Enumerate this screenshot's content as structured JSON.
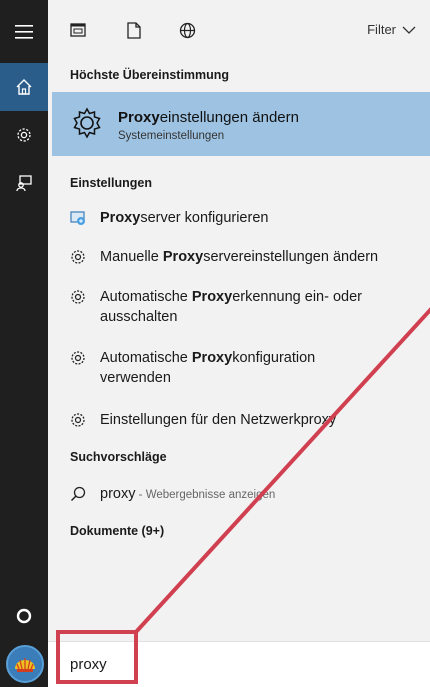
{
  "topbar": {
    "filter_label": "Filter",
    "icons": [
      "document-view-icon",
      "blank-document-icon",
      "globe-icon"
    ]
  },
  "best_match": {
    "heading": "Höchste Übereinstimmung",
    "title_bold": "Proxy",
    "title_rest": "einstellungen ändern",
    "subtitle": "Systemeinstellungen"
  },
  "settings": {
    "heading": "Einstellungen",
    "items": [
      {
        "pre": "",
        "bold": "Proxy",
        "post": "server konfigurieren",
        "line2": ""
      },
      {
        "pre": "Manuelle ",
        "bold": "Proxy",
        "post": "servereinstellungen ändern",
        "line2": ""
      },
      {
        "pre": "Automatische ",
        "bold": "Proxy",
        "post": "erkennung ein- oder",
        "line2": "ausschalten"
      },
      {
        "pre": "Automatische ",
        "bold": "Proxy",
        "post": "konfiguration",
        "line2": "verwenden"
      },
      {
        "pre": "Einstellungen für den Netzwerkproxy",
        "bold": "",
        "post": "",
        "line2": ""
      }
    ]
  },
  "suggestions": {
    "heading": "Suchvorschläge",
    "query": "proxy",
    "hint": " - Webergebnisse anzeigen"
  },
  "documents": {
    "heading": "Dokumente (9+)"
  },
  "search": {
    "value": "proxy"
  },
  "colors": {
    "accent": "#2b5d8a",
    "highlight": "#9ec3e2",
    "annotation": "#d04050"
  }
}
